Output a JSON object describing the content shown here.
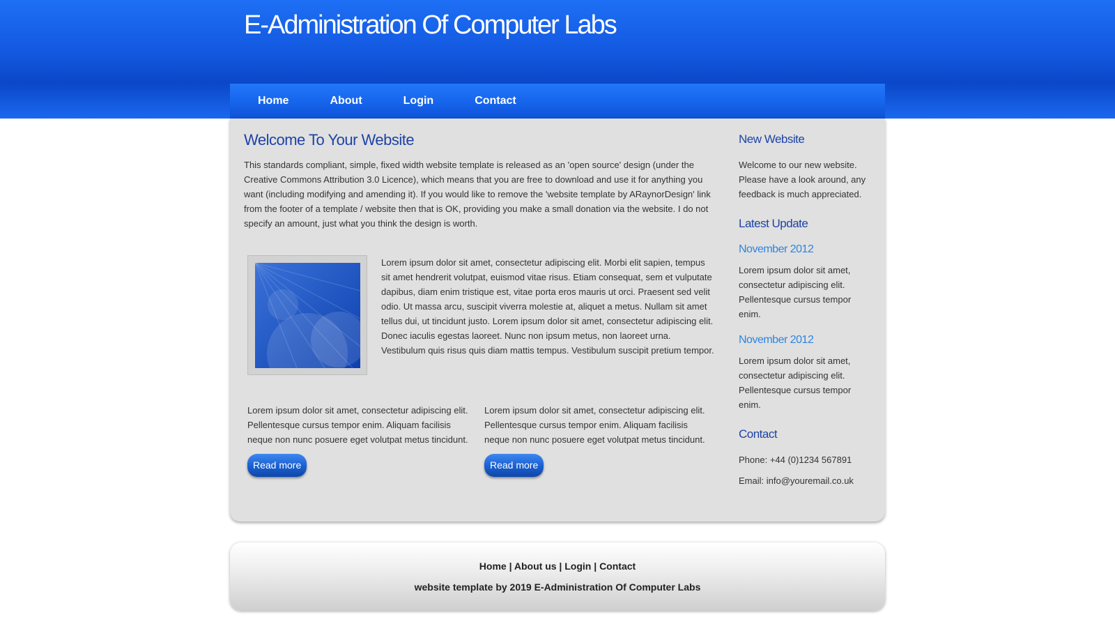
{
  "header": {
    "title": "E-Administration Of Computer Labs"
  },
  "nav": [
    {
      "label": "Home"
    },
    {
      "label": "About"
    },
    {
      "label": "Login"
    },
    {
      "label": "Contact"
    }
  ],
  "main": {
    "heading": "Welcome To Your Website",
    "intro": "This standards compliant, simple, fixed width website template is released as an 'open source' design (under the Creative Commons Attribution 3.0 Licence), which means that you are free to download and use it for anything you want (including modifying and amending it). If you would like to remove the 'website template by ARaynorDesign' link from the footer of a template / website then that is OK, providing you make a small donation via the website. I do not specify an amount, just what you think the design is worth.",
    "feature_text": "Lorem ipsum dolor sit amet, consectetur adipiscing elit. Morbi elit sapien, tempus sit amet hendrerit volutpat, euismod vitae risus. Etiam consequat, sem et vulputate dapibus, diam enim tristique est, vitae porta eros mauris ut orci. Praesent sed velit odio. Ut massa arcu, suscipit viverra molestie at, aliquet a metus. Nullam sit amet tellus dui, ut tincidunt justo. Lorem ipsum dolor sit amet, consectetur adipiscing elit. Donec iaculis egestas laoreet. Nunc non ipsum metus, non laoreet urna. Vestibulum quis risus quis diam mattis tempus. Vestibulum suscipit pretium tempor.",
    "columns": [
      {
        "text": "Lorem ipsum dolor sit amet, consectetur adipiscing elit. Pellentesque cursus tempor enim. Aliquam facilisis neque non nunc posuere eget volutpat metus tincidunt.",
        "button": "Read more"
      },
      {
        "text": "Lorem ipsum dolor sit amet, consectetur adipiscing elit. Pellentesque cursus tempor enim. Aliquam facilisis neque non nunc posuere eget volutpat metus tincidunt.",
        "button": "Read more"
      }
    ]
  },
  "sidebar": {
    "new_heading": "New Website",
    "new_text": "Welcome to our new website. Please have a look around, any feedback is much appreciated.",
    "update_heading": "Latest Update",
    "updates": [
      {
        "date": "November 2012",
        "text": "Lorem ipsum dolor sit amet, consectetur adipiscing elit. Pellentesque cursus tempor enim."
      },
      {
        "date": "November 2012",
        "text": "Lorem ipsum dolor sit amet, consectetur adipiscing elit. Pellentesque cursus tempor enim."
      }
    ],
    "contact_heading": "Contact",
    "phone": "Phone: +44 (0)1234 567891",
    "email": "Email: info@youremail.co.uk"
  },
  "footer": {
    "links": [
      {
        "label": "Home"
      },
      {
        "label": "About us"
      },
      {
        "label": "Login"
      },
      {
        "label": "Contact"
      }
    ],
    "separator": " | ",
    "credit": "website template by 2019 E-Administration Of Computer Labs"
  },
  "colors": {
    "brand_blue": "#1258df",
    "heading_blue": "#1d43a6",
    "date_blue": "#2d85e0",
    "panel_gray": "#e0e0e0"
  }
}
